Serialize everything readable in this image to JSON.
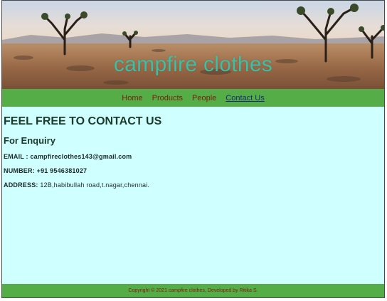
{
  "header": {
    "brand_title": "campfire clothes"
  },
  "nav": {
    "items": [
      {
        "label": "Home"
      },
      {
        "label": "Products"
      },
      {
        "label": "People"
      },
      {
        "label": "Contact Us",
        "active": true
      }
    ]
  },
  "main": {
    "heading": "FEEL FREE TO CONTACT US",
    "subheading": "For Enquiry",
    "email_label": "EMAIL : ",
    "email_value": "campfireclothes143@gmail.com",
    "number_label": "NUMBER: ",
    "number_value": "+91 9546381027",
    "address_label": "ADDRESS: ",
    "address_value": "12B,habibullah road,t.nagar,chennai."
  },
  "footer": {
    "copyright": "Copyright © 2021 campfire clothes, Developed by Ritika S."
  },
  "colors": {
    "nav_bg": "#55ad47",
    "page_bg": "#cfffff",
    "brand_text": "#3bbfa6",
    "link_text": "#7a1e10"
  }
}
